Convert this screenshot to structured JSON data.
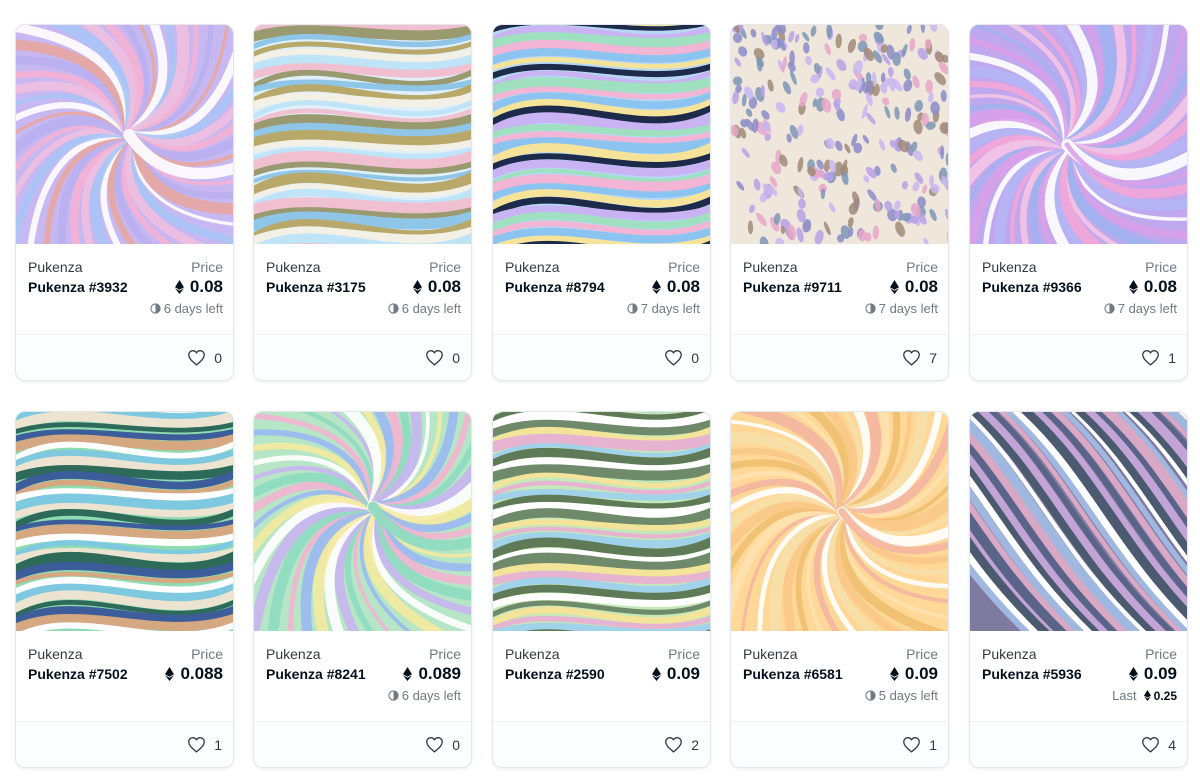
{
  "cards": [
    {
      "collection": "Pukenza",
      "name": "Pukenza #3932",
      "price_label": "Price",
      "price": "0.08",
      "time_left": "6 days left",
      "likes": "0",
      "art": {
        "type": "swirl",
        "bg": "#c8b8f2",
        "colors": [
          "#f4b2d4",
          "#b9b0f0",
          "#e8a6a0",
          "#ffffff",
          "#a7c4f5",
          "#f0c0e0"
        ]
      }
    },
    {
      "collection": "Pukenza",
      "name": "Pukenza #3175",
      "price_label": "Price",
      "price": "0.08",
      "time_left": "6 days left",
      "likes": "0",
      "art": {
        "type": "waves",
        "bg": "#dff0fb",
        "colors": [
          "#8fc6e8",
          "#b8a86a",
          "#f3f0e6",
          "#bfe3f7",
          "#f0c0d0",
          "#9a9a70"
        ]
      }
    },
    {
      "collection": "Pukenza",
      "name": "Pukenza #8794",
      "price_label": "Price",
      "price": "0.08",
      "time_left": "7 days left",
      "likes": "0",
      "art": {
        "type": "waves",
        "bg": "#b6d8f5",
        "colors": [
          "#9fe0c0",
          "#f2b5d5",
          "#8bc4f0",
          "#f5e39a",
          "#1e2a4a",
          "#c9b3f2"
        ]
      }
    },
    {
      "collection": "Pukenza",
      "name": "Pukenza #9711",
      "price_label": "Price",
      "price": "0.08",
      "time_left": "7 days left",
      "likes": "7",
      "art": {
        "type": "dots",
        "bg": "#efe6dc",
        "colors": [
          "#b9a0e6",
          "#8a8cc8",
          "#e6a6c8",
          "#7d95b5",
          "#c8b6f0",
          "#a08a78"
        ]
      }
    },
    {
      "collection": "Pukenza",
      "name": "Pukenza #9366",
      "price_label": "Price",
      "price": "0.08",
      "time_left": "7 days left",
      "likes": "1",
      "art": {
        "type": "swirl",
        "bg": "#c0a8ef",
        "colors": [
          "#f2a6d8",
          "#b4b6f5",
          "#ffffff",
          "#d8a0e8",
          "#9fb2ee",
          "#f4c4e4"
        ]
      }
    },
    {
      "collection": "Pukenza",
      "name": "Pukenza #7502",
      "price_label": "Price",
      "price": "0.088",
      "time_left": "",
      "likes": "1",
      "art": {
        "type": "waves",
        "bg": "#8fdcb2",
        "colors": [
          "#2e6a5a",
          "#3c5d9a",
          "#d6a882",
          "#ffffff",
          "#7ec9e0",
          "#ece4d0"
        ]
      }
    },
    {
      "collection": "Pukenza",
      "name": "Pukenza #8241",
      "price_label": "Price",
      "price": "0.089",
      "time_left": "6 days left",
      "likes": "0",
      "art": {
        "type": "swirl",
        "bg": "#b6e6c6",
        "colors": [
          "#f4ea9e",
          "#9ab8f2",
          "#f2b4d0",
          "#8edcc0",
          "#c8b4f0",
          "#ffffff"
        ]
      }
    },
    {
      "collection": "Pukenza",
      "name": "Pukenza #2590",
      "price_label": "Price",
      "price": "0.09",
      "time_left": "",
      "likes": "2",
      "art": {
        "type": "waves",
        "bg": "#c4e8b8",
        "colors": [
          "#6f8a6a",
          "#f3e49a",
          "#e6b4d0",
          "#a0d2ea",
          "#5e7a56",
          "#ffffff"
        ]
      }
    },
    {
      "collection": "Pukenza",
      "name": "Pukenza #6581",
      "price_label": "Price",
      "price": "0.09",
      "time_left": "5 days left",
      "likes": "1",
      "art": {
        "type": "swirl",
        "bg": "#ffd796",
        "colors": [
          "#fbc98a",
          "#f6e0a8",
          "#ffffff",
          "#f4b6a0",
          "#ffe2b0",
          "#f0c070"
        ]
      }
    },
    {
      "collection": "Pukenza",
      "name": "Pukenza #5936",
      "price_label": "Price",
      "price": "0.09",
      "time_left": "",
      "last_label": "Last",
      "last_price": "0.25",
      "likes": "4",
      "art": {
        "type": "diagonal",
        "bg": "#7e7aa0",
        "colors": [
          "#5a6488",
          "#d8a8c4",
          "#a0b8e0",
          "#ffffff",
          "#4c5a70",
          "#c2a4d6"
        ]
      }
    }
  ]
}
